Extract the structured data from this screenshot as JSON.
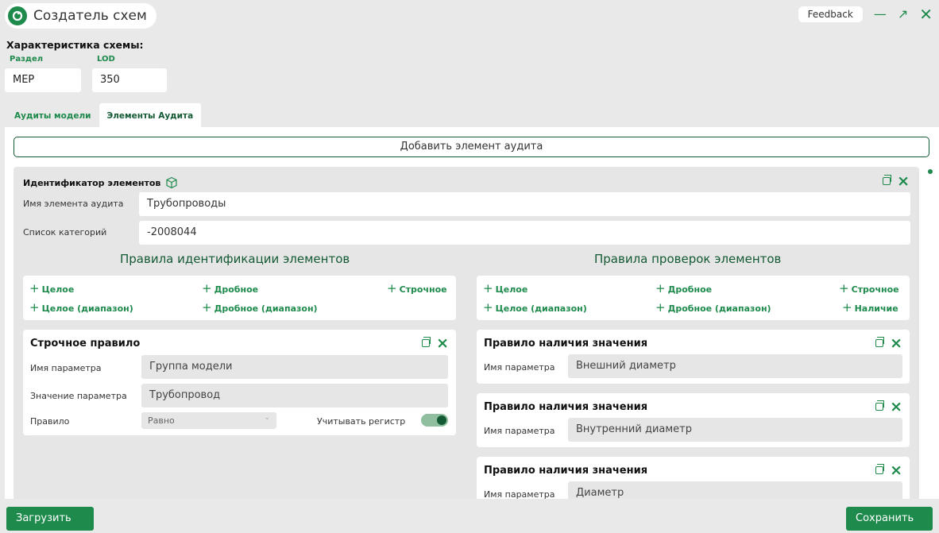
{
  "app": {
    "title": "Создатель схем",
    "feedback_label": "Feedback"
  },
  "characteristics": {
    "title": "Характеристика схемы:",
    "section_label": "Раздел",
    "section_value": "MEP",
    "lod_label": "LOD",
    "lod_value": "350"
  },
  "tabs": [
    {
      "label": "Аудиты модели"
    },
    {
      "label": "Элементы Аудита"
    }
  ],
  "panel": {
    "add_button": "Добавить элемент аудита",
    "card": {
      "title": "Идентификатор элементов",
      "name_label": "Имя элемента аудита",
      "name_value": "Трубопроводы",
      "categories_label": "Список категорий",
      "categories_value": "-2008044",
      "identification": {
        "title": "Правила идентификации элементов",
        "add_items": [
          "Целое",
          "Дробное",
          "Строчное",
          "Целое (диапазон)",
          "Дробное (диапазон)"
        ],
        "rule": {
          "title": "Строчное правило",
          "param_label": "Имя параметра",
          "param_value": "Группа модели",
          "value_label": "Значение параметра",
          "value_value": "Трубопровод",
          "rule_label": "Правило",
          "rule_value": "Равно",
          "case_label": "Учитывать регистр"
        }
      },
      "checks": {
        "title": "Правила проверок элементов",
        "add_items": [
          "Целое",
          "Дробное",
          "Строчное",
          "Целое (диапазон)",
          "Дробное (диапазон)",
          "Наличие"
        ],
        "rules": [
          {
            "title": "Правило наличия значения",
            "param_label": "Имя параметра",
            "param_value": "Внешний диаметр"
          },
          {
            "title": "Правило наличия значения",
            "param_label": "Имя параметра",
            "param_value": "Внутренний диаметр"
          },
          {
            "title": "Правило наличия значения",
            "param_label": "Имя параметра",
            "param_value": "Диаметр"
          }
        ]
      }
    }
  },
  "footer": {
    "load_label": "Загрузить",
    "save_label": "Сохранить"
  },
  "colors": {
    "accent": "#1e8a4c",
    "dark_accent": "#145a34",
    "background": "#e9e9e9"
  }
}
